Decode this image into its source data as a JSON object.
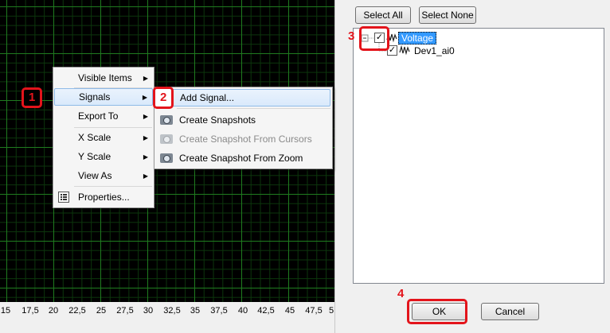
{
  "graph": {
    "x_ticks": [
      "15",
      "17,5",
      "20",
      "22,5",
      "25",
      "27,5",
      "30",
      "32,5",
      "35",
      "37,5",
      "40",
      "42,5",
      "45",
      "47,5",
      "5"
    ]
  },
  "context_menu": {
    "items": [
      {
        "label": "Visible Items"
      },
      {
        "label": "Signals"
      },
      {
        "label": "Export To"
      },
      {
        "label": "X Scale"
      },
      {
        "label": "Y Scale"
      },
      {
        "label": "View As"
      },
      {
        "label": "Properties..."
      }
    ]
  },
  "submenu": {
    "items": [
      {
        "label": "Add Signal..."
      },
      {
        "label": "Create Snapshots"
      },
      {
        "label": "Create Snapshot From Cursors"
      },
      {
        "label": "Create Snapshot From Zoom"
      }
    ]
  },
  "signal_panel": {
    "select_all": "Select All",
    "select_none": "Select None",
    "tree": {
      "root_label": "Voltage",
      "child_label": "Dev1_ai0"
    },
    "ok": "OK",
    "cancel": "Cancel"
  },
  "annotations": {
    "step1": "1",
    "step2": "2",
    "step3": "3",
    "step4": "4"
  },
  "colors": {
    "highlight": "#e3141b",
    "grid": "#1f7a1f",
    "selection": "#3399ff"
  }
}
